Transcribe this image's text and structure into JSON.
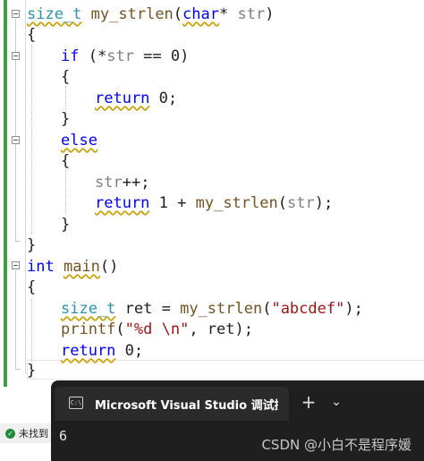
{
  "editor": {
    "lines": [
      {
        "id": "l1",
        "tokens": [
          {
            "t": "size_t",
            "c": "tp",
            "u": "squig"
          },
          {
            "t": " ",
            "c": ""
          },
          {
            "t": "my_strlen",
            "c": "fn"
          },
          {
            "t": "(",
            "c": ""
          },
          {
            "t": "char",
            "c": "kw",
            "u": "squig"
          },
          {
            "t": "* ",
            "c": ""
          },
          {
            "t": "str",
            "c": "pm"
          },
          {
            "t": ")",
            "c": ""
          }
        ]
      },
      {
        "id": "l2",
        "tokens": [
          {
            "t": "{",
            "c": ""
          }
        ]
      },
      {
        "id": "l3",
        "tokens": [
          {
            "t": "if",
            "c": "kw"
          },
          {
            "t": " (*",
            "c": ""
          },
          {
            "t": "str",
            "c": "pm"
          },
          {
            "t": " == 0)",
            "c": ""
          }
        ]
      },
      {
        "id": "l4",
        "tokens": [
          {
            "t": "{",
            "c": ""
          }
        ]
      },
      {
        "id": "l5",
        "tokens": [
          {
            "t": "return",
            "c": "kw",
            "u": "squig"
          },
          {
            "t": " 0;",
            "c": ""
          }
        ]
      },
      {
        "id": "l6",
        "tokens": [
          {
            "t": "}",
            "c": ""
          }
        ]
      },
      {
        "id": "l7",
        "tokens": [
          {
            "t": "else",
            "c": "kw",
            "u": "squig"
          }
        ]
      },
      {
        "id": "l8",
        "tokens": [
          {
            "t": "{",
            "c": ""
          }
        ]
      },
      {
        "id": "l9",
        "tokens": [
          {
            "t": "str",
            "c": "pm"
          },
          {
            "t": "++;",
            "c": ""
          }
        ]
      },
      {
        "id": "l10",
        "tokens": [
          {
            "t": "return",
            "c": "kw",
            "u": "squig"
          },
          {
            "t": " 1 + ",
            "c": ""
          },
          {
            "t": "my_strlen",
            "c": "fn"
          },
          {
            "t": "(",
            "c": ""
          },
          {
            "t": "str",
            "c": "pm"
          },
          {
            "t": ");",
            "c": ""
          }
        ]
      },
      {
        "id": "l11",
        "tokens": [
          {
            "t": "}",
            "c": ""
          }
        ]
      },
      {
        "id": "l12",
        "tokens": [
          {
            "t": "}",
            "c": ""
          }
        ]
      },
      {
        "id": "l13",
        "tokens": [
          {
            "t": "int",
            "c": "kw"
          },
          {
            "t": " ",
            "c": ""
          },
          {
            "t": "main",
            "c": "fn",
            "u": "squig"
          },
          {
            "t": "()",
            "c": ""
          }
        ]
      },
      {
        "id": "l14",
        "tokens": [
          {
            "t": "{",
            "c": ""
          }
        ]
      },
      {
        "id": "l15",
        "tokens": [
          {
            "t": "size_t",
            "c": "tp",
            "u": "squig"
          },
          {
            "t": " ret = ",
            "c": ""
          },
          {
            "t": "my_strlen",
            "c": "fn"
          },
          {
            "t": "(",
            "c": ""
          },
          {
            "t": "\"abcdef\"",
            "c": "str"
          },
          {
            "t": ");",
            "c": ""
          }
        ]
      },
      {
        "id": "l16",
        "tokens": [
          {
            "t": "printf",
            "c": "fn"
          },
          {
            "t": "(",
            "c": ""
          },
          {
            "t": "\"%d \\n\"",
            "c": "str"
          },
          {
            "t": ", ret);",
            "c": ""
          }
        ]
      },
      {
        "id": "l17",
        "tokens": [
          {
            "t": "return",
            "c": "kw",
            "u": "squig"
          },
          {
            "t": " 0;",
            "c": ""
          }
        ]
      },
      {
        "id": "l18",
        "tokens": [
          {
            "t": "}",
            "c": ""
          }
        ]
      }
    ]
  },
  "status": {
    "text": "未找到",
    "icon": "check-circle-icon"
  },
  "terminal": {
    "tab_icon_text": "C:\\",
    "tab_title": "Microsoft Visual Studio 调试控制台",
    "new_tab_icon": "+",
    "dropdown_icon": "⌄",
    "output": "6"
  },
  "watermark": "CSDN @小白不是程序媛",
  "colors": {
    "keyword": "#0000ff",
    "type": "#2b91af",
    "function": "#74531f",
    "string": "#a31515",
    "param": "#808080",
    "change_bar": "#3f9e45",
    "terminal_bg": "#1f1f1f"
  }
}
